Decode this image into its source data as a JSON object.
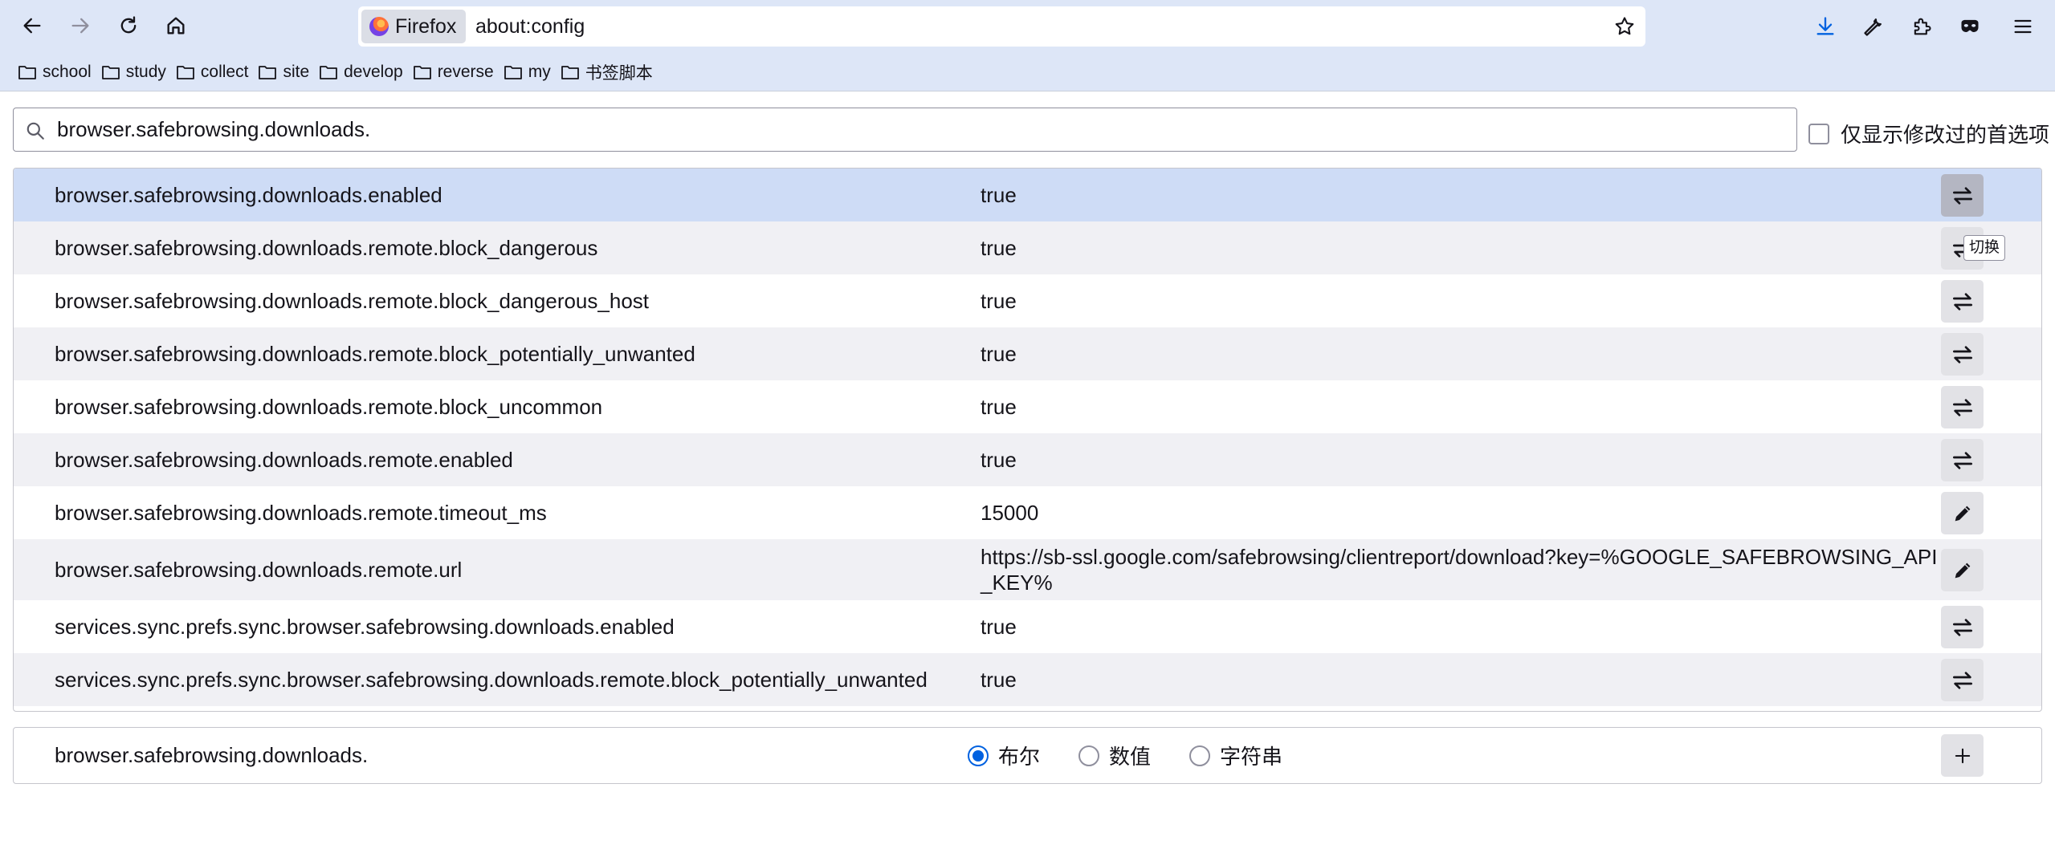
{
  "browser": {
    "identity_label": "Firefox",
    "url": "about:config"
  },
  "bookmarks": [
    {
      "label": "school"
    },
    {
      "label": "study"
    },
    {
      "label": "collect"
    },
    {
      "label": "site"
    },
    {
      "label": "develop"
    },
    {
      "label": "reverse"
    },
    {
      "label": "my"
    },
    {
      "label": "书签脚本"
    }
  ],
  "config": {
    "search_value": "browser.safebrowsing.downloads.",
    "modified_only_label": "仅显示修改过的首选项",
    "modified_only_checked": false,
    "tooltip": "切换",
    "rows": [
      {
        "name": "browser.safebrowsing.downloads.enabled",
        "value": "true",
        "action": "toggle",
        "selected": true
      },
      {
        "name": "browser.safebrowsing.downloads.remote.block_dangerous",
        "value": "true",
        "action": "toggle"
      },
      {
        "name": "browser.safebrowsing.downloads.remote.block_dangerous_host",
        "value": "true",
        "action": "toggle"
      },
      {
        "name": "browser.safebrowsing.downloads.remote.block_potentially_unwanted",
        "value": "true",
        "action": "toggle"
      },
      {
        "name": "browser.safebrowsing.downloads.remote.block_uncommon",
        "value": "true",
        "action": "toggle"
      },
      {
        "name": "browser.safebrowsing.downloads.remote.enabled",
        "value": "true",
        "action": "toggle"
      },
      {
        "name": "browser.safebrowsing.downloads.remote.timeout_ms",
        "value": "15000",
        "action": "edit"
      },
      {
        "name": "browser.safebrowsing.downloads.remote.url",
        "value": "https://sb-ssl.google.com/safebrowsing/clientreport/download?key=%GOOGLE_SAFEBROWSING_API_KEY%",
        "action": "edit"
      },
      {
        "name": "services.sync.prefs.sync.browser.safebrowsing.downloads.enabled",
        "value": "true",
        "action": "toggle"
      },
      {
        "name": "services.sync.prefs.sync.browser.safebrowsing.downloads.remote.block_potentially_unwanted",
        "value": "true",
        "action": "toggle"
      }
    ],
    "add_row": {
      "name": "browser.safebrowsing.downloads.",
      "types": [
        {
          "label": "布尔",
          "checked": true
        },
        {
          "label": "数值",
          "checked": false
        },
        {
          "label": "字符串",
          "checked": false
        }
      ]
    }
  },
  "colors": {
    "chrome_bg": "#dde6f7",
    "selected_row": "#cedcf6",
    "accent": "#0061e0"
  }
}
